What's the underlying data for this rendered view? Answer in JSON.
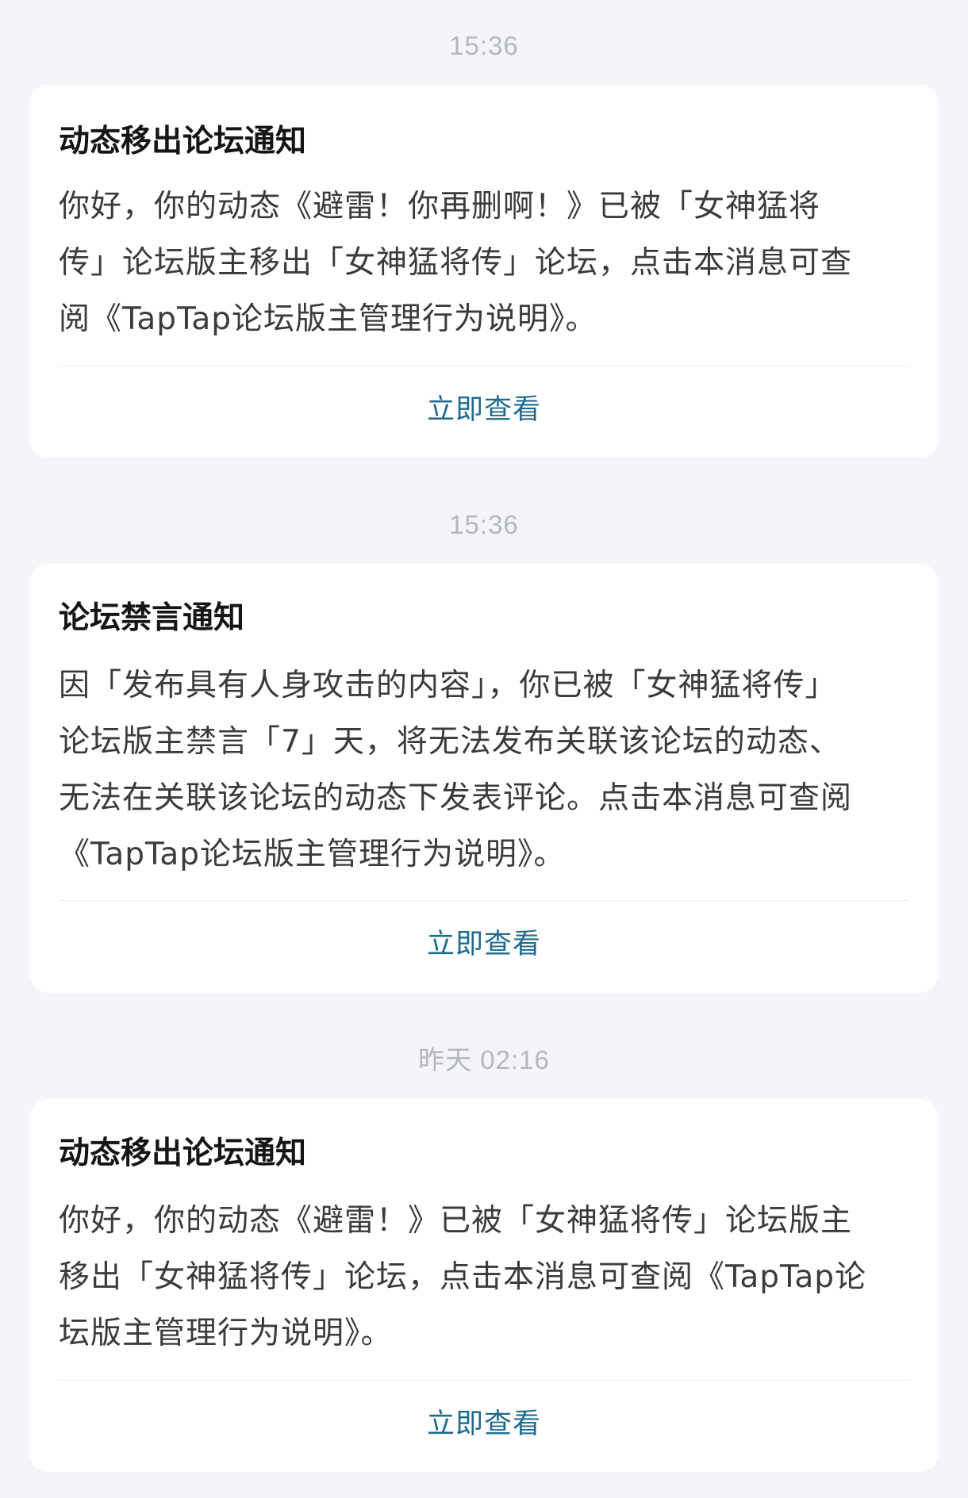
{
  "notifications": [
    {
      "time": "15:36",
      "title": "动态移出论坛通知",
      "lines": [
        "你好，你的动态《避雷！你再删啊！》已被「女神猛将",
        "传」论坛版主移出「女神猛将传」论坛，点击本消息可查",
        "阅《TapTap论坛版主管理行为说明》。"
      ],
      "action_label": "立即查看"
    },
    {
      "time": "15:36",
      "title": "论坛禁言通知",
      "lines": [
        "因「发布具有人身攻击的内容」，你已被「女神猛将传」",
        "论坛版主禁言「7」天，将无法发布关联该论坛的动态、",
        "无法在关联该论坛的动态下发表评论。点击本消息可查阅",
        "《TapTap论坛版主管理行为说明》。"
      ],
      "action_label": "立即查看"
    },
    {
      "time": "昨天  02:16",
      "title": "动态移出论坛通知",
      "lines": [
        "你好，你的动态《避雷！》已被「女神猛将传」论坛版主",
        "移出「女神猛将传」论坛，点击本消息可查阅《TapTap论",
        "坛版主管理行为说明》。"
      ],
      "action_label": "立即查看"
    }
  ]
}
